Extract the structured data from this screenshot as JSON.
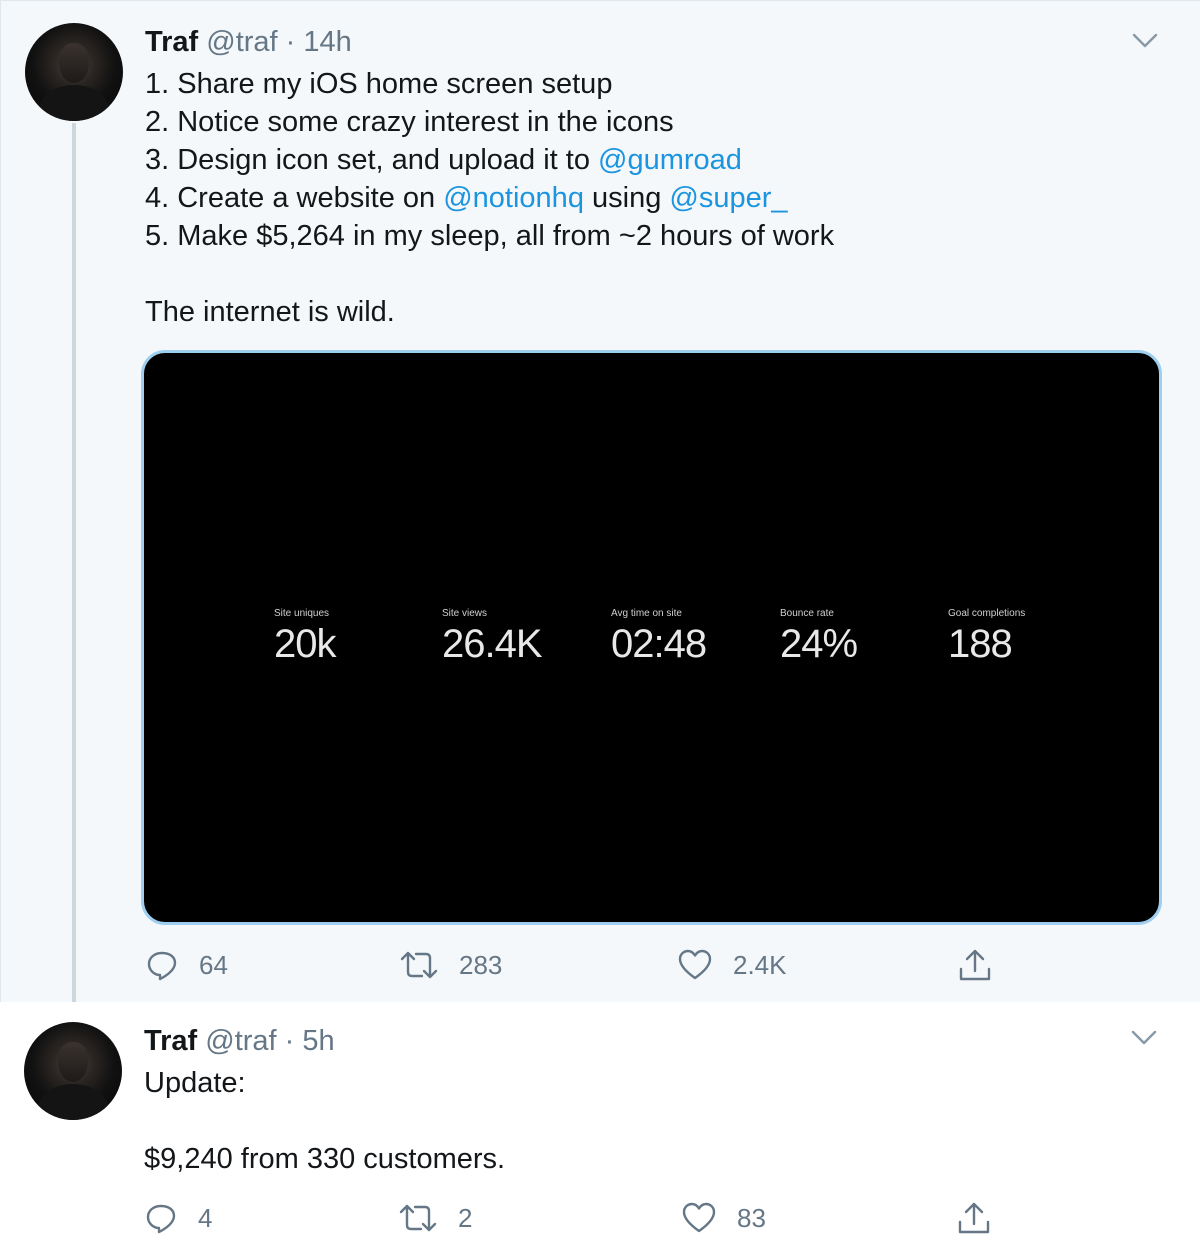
{
  "tweets": [
    {
      "name": "Traf",
      "handle": "@traf",
      "dot": "·",
      "time": "14h",
      "lines": [
        {
          "parts": [
            {
              "text": "1. Share my iOS home screen setup"
            }
          ]
        },
        {
          "parts": [
            {
              "text": "2. Notice some crazy interest in the icons"
            }
          ]
        },
        {
          "parts": [
            {
              "text": "3. Design icon set, and upload it to "
            },
            {
              "text": "@gumroad"
            }
          ]
        },
        {
          "parts": [
            {
              "text": "4. Create a website on "
            },
            {
              "text": "@notionhq"
            },
            {
              "text": " using "
            },
            {
              "text": "@super_"
            }
          ]
        },
        {
          "parts": [
            {
              "text": "5. Make $5,264 in my sleep, all from ~2 hours of work"
            }
          ]
        },
        {
          "parts": [
            {
              "text": ""
            }
          ]
        },
        {
          "parts": [
            {
              "text": "The internet is wild."
            }
          ]
        }
      ],
      "media": {
        "stats": [
          {
            "label": "Site uniques",
            "value": "20k"
          },
          {
            "label": "Site views",
            "value": "26.4K"
          },
          {
            "label": "Avg time on site",
            "value": "02:48"
          },
          {
            "label": "Bounce rate",
            "value": "24%"
          },
          {
            "label": "Goal completions",
            "value": "188"
          }
        ]
      },
      "actions": {
        "replies": "64",
        "retweets": "283",
        "likes": "2.4K"
      }
    },
    {
      "name": "Traf",
      "handle": "@traf",
      "dot": "·",
      "time": "5h",
      "lines": [
        {
          "parts": [
            {
              "text": "Update:"
            }
          ]
        },
        {
          "parts": [
            {
              "text": ""
            }
          ]
        },
        {
          "parts": [
            {
              "text": "$9,240 from 330 customers."
            }
          ]
        }
      ],
      "actions": {
        "replies": "4",
        "retweets": "2",
        "likes": "83"
      }
    }
  ],
  "icons": {
    "reply": "reply-icon",
    "retweet": "retweet-icon",
    "like": "heart-icon",
    "share": "share-icon",
    "menu": "chevron-down-icon"
  },
  "colors": {
    "mention": "#1b95e0",
    "secondary": "#657786",
    "thread_line": "#ccd6dd",
    "media_border": "#9fcff0"
  }
}
